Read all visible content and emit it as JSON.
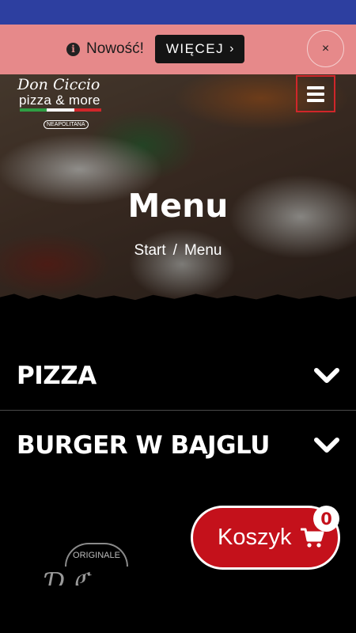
{
  "notice": {
    "icon": "info-circle-icon",
    "text": "Nowość!",
    "button_label": "WIĘCEJ",
    "button_icon": "›",
    "close_label": "×"
  },
  "header": {
    "logo_script": "Don Ciccio",
    "logo_tagline": "pizza & more",
    "logo_badge": "NEAPOLITANA",
    "flag_colors": [
      "#2f9e44",
      "#ffffff",
      "#d0262a"
    ],
    "menu_icon": "hamburger-menu-icon"
  },
  "hero": {
    "title": "Menu",
    "breadcrumb": [
      "Start",
      "/",
      "Menu"
    ]
  },
  "sections": [
    {
      "label": "PIZZA",
      "icon": "chevron-down-icon"
    },
    {
      "label": "BURGER W BAJGLU",
      "icon": "chevron-down-icon"
    }
  ],
  "footer_logo": {
    "arc_text": "ORIGINALE"
  },
  "cart": {
    "label": "Koszyk",
    "icon": "cart-icon",
    "count": "0"
  },
  "colors": {
    "status_bar": "#2d3fa0",
    "notice_bg": "#e6898a",
    "accent": "#c4111b",
    "menu_border": "#d0262a"
  }
}
